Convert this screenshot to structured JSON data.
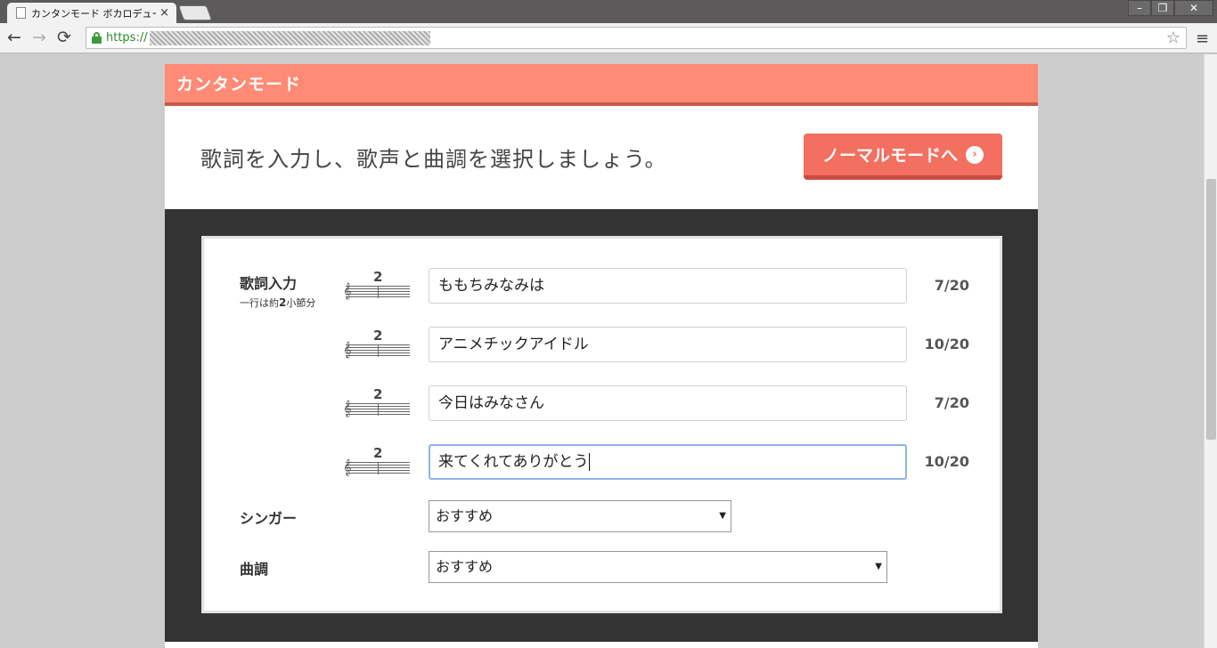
{
  "browser": {
    "tab_title": "カンタンモード ボカロデューサ",
    "tab_close": "×",
    "url_scheme": "https://",
    "window_buttons": [
      "–",
      "❐",
      "✕"
    ],
    "nav_icons": {
      "back": "←",
      "forward": "→",
      "reload": "⟳",
      "star": "☆",
      "menu": "≡"
    }
  },
  "header": {
    "title": "カンタンモード"
  },
  "intro": {
    "text": "歌詞を入力し、歌声と曲調を選択しましょう。",
    "normal_mode_button": "ノーマルモードへ",
    "arrow_glyph": "›"
  },
  "form": {
    "lyrics_label": "歌詞入力",
    "lyrics_hint_pre": "一行は約",
    "lyrics_hint_num": "2",
    "lyrics_hint_post": "小節分",
    "rows": [
      {
        "measures": "2",
        "value": "ももちみなみは",
        "count": "7/20"
      },
      {
        "measures": "2",
        "value": "アニメチックアイドル",
        "count": "10/20"
      },
      {
        "measures": "2",
        "value": "今日はみなさん",
        "count": "7/20"
      },
      {
        "measures": "2",
        "value": "来てくれてありがとう",
        "count": "10/20"
      }
    ],
    "clef_glyph": "𝄞",
    "singer": {
      "label": "シンガー",
      "selected": "おすすめ"
    },
    "tune": {
      "label": "曲調",
      "selected": "おすすめ"
    },
    "select_arrow": "▼"
  },
  "colors": {
    "header": "#ff8a75",
    "button": "#f36f60",
    "dark_area": "#333333"
  }
}
